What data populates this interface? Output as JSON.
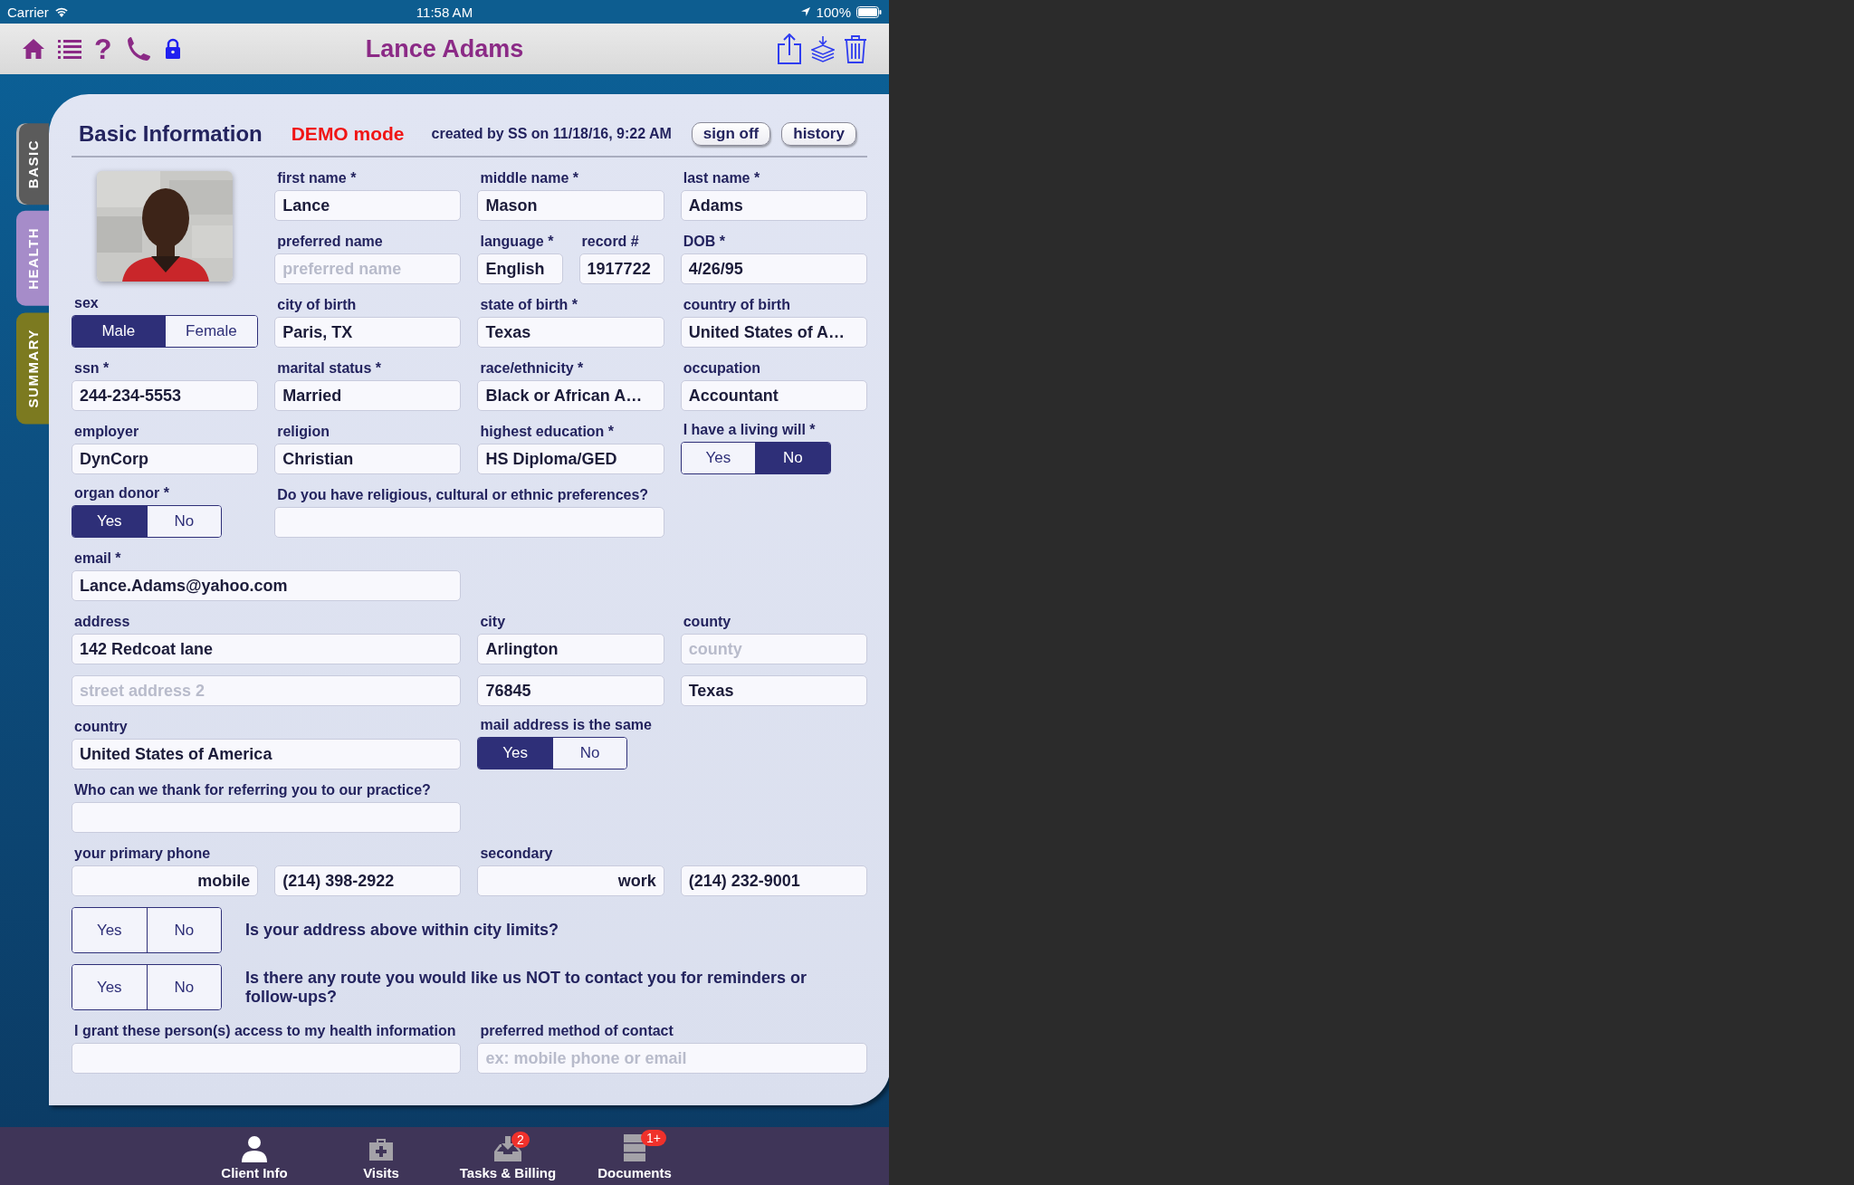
{
  "status_bar": {
    "carrier": "Carrier",
    "time": "11:58 AM",
    "battery": "100%"
  },
  "nav_bar": {
    "help_icon": "?",
    "title": "Lance Adams"
  },
  "side_tabs": [
    {
      "label": "BASIC",
      "selected": true,
      "color": "#5b5b5b"
    },
    {
      "label": "HEALTH",
      "selected": false,
      "color": "#a68cc9"
    },
    {
      "label": "SUMMARY",
      "selected": false,
      "color": "#7c7a20"
    }
  ],
  "form": {
    "title": "Basic Information",
    "mode": "DEMO mode",
    "created": "created by SS on 11/18/16, 9:22 AM",
    "buttons": [
      "sign off",
      "history"
    ],
    "fields": [
      {
        "kind": "picture"
      },
      {
        "kind": "text",
        "label": "first name *",
        "value": "Lance"
      },
      {
        "kind": "text",
        "label": "middle name *",
        "value": "Mason"
      },
      {
        "kind": "text",
        "label": "last name *",
        "value": "Adams"
      },
      {
        "kind": "text",
        "label": "preferred name",
        "placeholder": "preferred name"
      },
      {
        "kind": "text",
        "label": "language *",
        "value": "English"
      },
      {
        "kind": "text",
        "label": "record #",
        "value": "1917722"
      },
      {
        "kind": "text",
        "label": "DOB *",
        "value": "4/26/95"
      },
      {
        "kind": "segmented",
        "label": "sex",
        "options": [
          {
            "label": "Male",
            "selected": true
          },
          {
            "label": "Female",
            "selected": false
          }
        ]
      },
      {
        "kind": "text",
        "label": "city of birth",
        "value": "Paris, TX"
      },
      {
        "kind": "text",
        "label": "state of birth *",
        "value": "Texas"
      },
      {
        "kind": "text",
        "label": "country of birth",
        "value": "United States of A…"
      },
      {
        "kind": "text",
        "label": "ssn *",
        "value": "244-234-5553"
      },
      {
        "kind": "text",
        "label": "marital status *",
        "value": "Married"
      },
      {
        "kind": "text",
        "label": "race/ethnicity *",
        "value": "Black or African A…"
      },
      {
        "kind": "text",
        "label": "occupation",
        "value": "Accountant"
      },
      {
        "kind": "text",
        "label": "employer",
        "value": "DynCorp"
      },
      {
        "kind": "text",
        "label": "religion",
        "value": "Christian"
      },
      {
        "kind": "text",
        "label": "highest education *",
        "value": "HS Diploma/GED"
      },
      {
        "kind": "segmented",
        "label": "I have a living will *",
        "options": [
          {
            "label": "Yes",
            "selected": false
          },
          {
            "label": "No",
            "selected": true
          }
        ]
      },
      {
        "kind": "segmented",
        "label": "organ donor *",
        "options": [
          {
            "label": "Yes",
            "selected": true
          },
          {
            "label": "No",
            "selected": false
          }
        ]
      },
      {
        "kind": "text",
        "label": "Do you have religious, cultural or ethnic preferences?"
      },
      {
        "kind": "text",
        "label": "email *",
        "value": "Lance.Adams@yahoo.com"
      },
      {
        "kind": "text",
        "label": "address",
        "value": "142 Redcoat lane"
      },
      {
        "kind": "text",
        "label": "city",
        "value": "Arlington"
      },
      {
        "kind": "text",
        "label": "county",
        "placeholder": "county"
      },
      {
        "kind": "text",
        "placeholder": "street address 2"
      },
      {
        "kind": "text",
        "value": "76845"
      },
      {
        "kind": "text",
        "value": "Texas"
      },
      {
        "kind": "text",
        "label": "country",
        "value": "United States of America"
      },
      {
        "kind": "segmented",
        "label": "mail address is the same",
        "options": [
          {
            "label": "Yes",
            "selected": true
          },
          {
            "label": "No",
            "selected": false
          }
        ]
      },
      {
        "kind": "text",
        "label": "Who can we thank for referring you to our practice?"
      },
      {
        "kind": "select",
        "label": "your primary phone",
        "value": "mobile"
      },
      {
        "kind": "text",
        "value": "(214) 398-2922"
      },
      {
        "kind": "select",
        "label": "secondary",
        "value": "work"
      },
      {
        "kind": "text",
        "value": "(214) 232-9001"
      },
      {
        "kind": "question",
        "question": "Is your address above within city limits?",
        "options": [
          {
            "label": "Yes",
            "selected": false
          },
          {
            "label": "No",
            "selected": false
          }
        ]
      },
      {
        "kind": "question",
        "question": "Is there any route you would like us NOT to contact you for reminders or follow-ups?",
        "options": [
          {
            "label": "Yes",
            "selected": false
          },
          {
            "label": "No",
            "selected": false
          }
        ]
      },
      {
        "kind": "text",
        "label": "I grant these person(s) access to my health information"
      },
      {
        "kind": "text",
        "label": "preferred method of contact",
        "placeholder": "ex: mobile phone or email"
      }
    ]
  },
  "tab_bar": [
    {
      "label": "Client Info",
      "selected": true
    },
    {
      "label": "Visits",
      "selected": false
    },
    {
      "label": "Tasks & Billing",
      "selected": false,
      "badge": "2"
    },
    {
      "label": "Documents",
      "selected": false,
      "badge": "1+"
    }
  ]
}
